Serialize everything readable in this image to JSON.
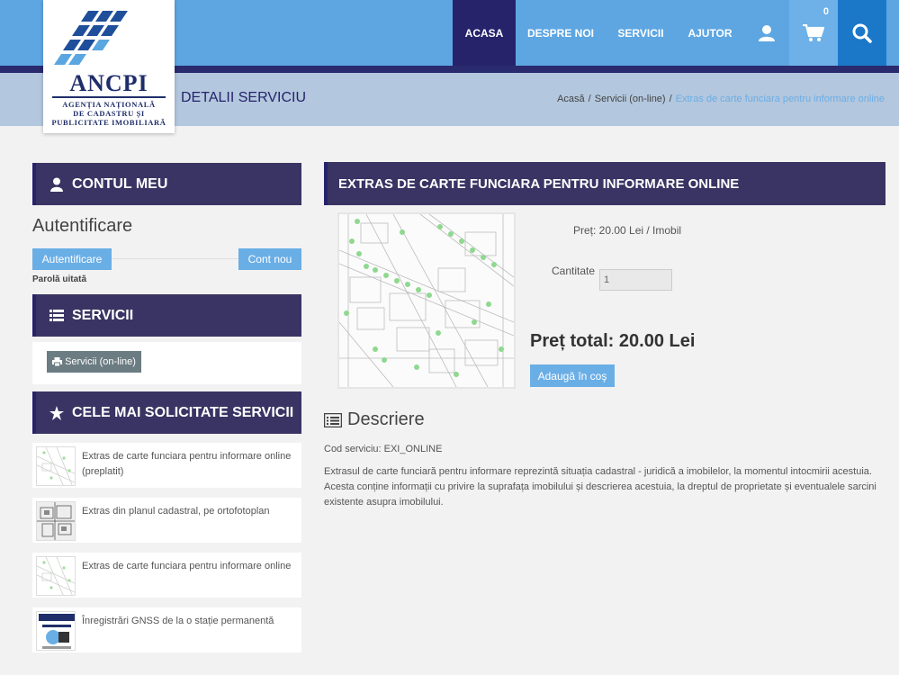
{
  "nav": {
    "items": [
      "ACASA",
      "DESPRE NOI",
      "SERVICII",
      "AJUTOR"
    ],
    "active_index": 0,
    "cart_count": "0",
    "icons": [
      "user-icon",
      "cart-icon",
      "search-icon"
    ]
  },
  "logo": {
    "name": "ANCPI",
    "sub1": "AGENȚIA NAȚIONALĂ",
    "sub2": "DE CADASTRU ȘI",
    "sub3": "PUBLICITATE IMOBILIARĂ"
  },
  "page": {
    "title": "DETALII SERVICIU",
    "breadcrumb": [
      "Acasă",
      "Servicii (on-line)",
      "Extras de carte funciara pentru informare online"
    ],
    "breadcrumb_sep": "/"
  },
  "sidebar": {
    "account_heading": "CONTUL MEU",
    "auth_title": "Autentificare",
    "login_button": "Autentificare",
    "new_account_button": "Cont nou",
    "forgot_password": "Parolă uitată",
    "services_heading": "SERVICII",
    "services_button": "Servicii (on-line)",
    "popular_heading": "CELE MAI SOLICITATE SERVICII",
    "popular_items": [
      "Extras de carte funciara pentru informare online (preplatit)",
      "Extras din planul cadastral, pe ortofotoplan",
      "Extras de carte funciara pentru informare online",
      "Înregistrări GNSS de la o stație permanentă"
    ]
  },
  "product": {
    "heading": "EXTRAS DE CARTE FUNCIARA PENTRU INFORMARE ONLINE",
    "price": "Preț: 20.00 Lei / Imobil",
    "qty_label": "Cantitate",
    "qty_value": "1",
    "total": "Preț total: 20.00 Lei",
    "add_button": "Adaugă în coş",
    "desc_title": "Descriere",
    "code": "Cod serviciu: EXI_ONLINE",
    "description": "Extrasul de carte funciară pentru informare reprezintă situația cadastral - juridică a imobilelor, la momentul intocmirii acestuia. Acesta conține informații cu privire la suprafața imobilului și descrierea acestuia, la dreptul de proprietate și eventualele sarcini existente asupra imobilului."
  },
  "colors": {
    "nav_bg": "#5da6e2",
    "nav_active": "#26236b",
    "panel_head": "#393463",
    "accent_blue": "#6aaee6"
  }
}
